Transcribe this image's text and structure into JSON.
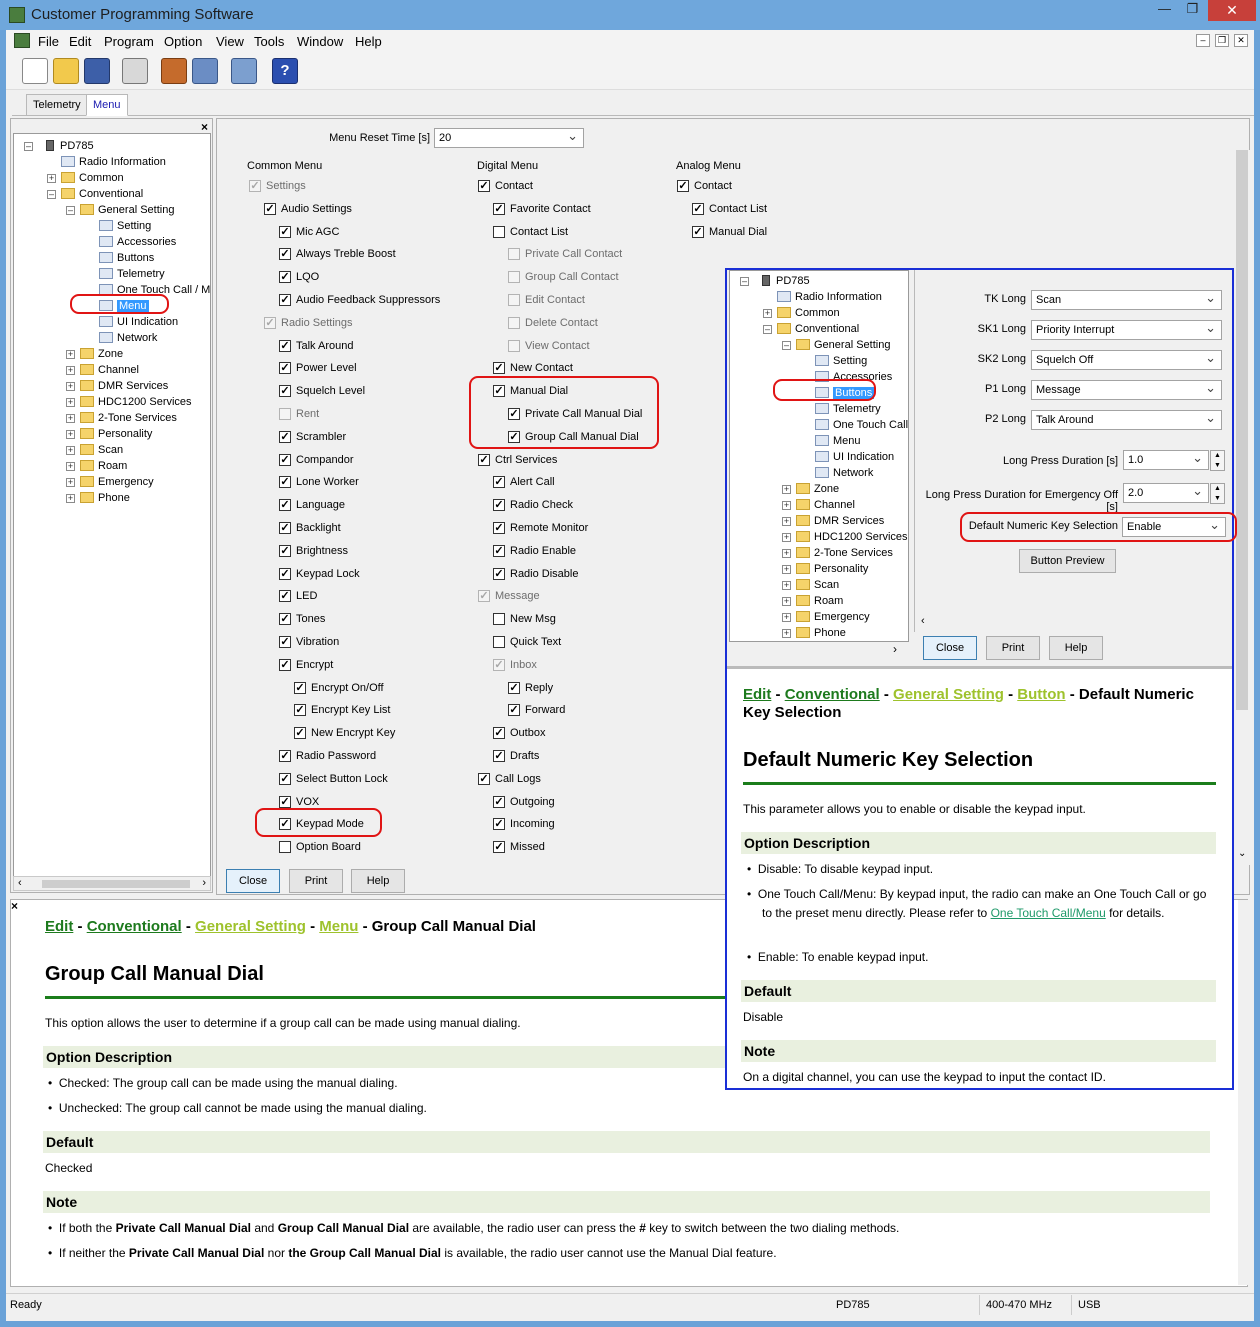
{
  "app_title": "Customer Programming Software",
  "menubar": [
    "File",
    "Edit",
    "Program",
    "Option",
    "View",
    "Tools",
    "Window",
    "Help"
  ],
  "tabs": [
    "Telemetry",
    "Menu"
  ],
  "tree": {
    "root": "PD785",
    "items": [
      {
        "label": "Radio Information",
        "level": 1,
        "type": "leaf"
      },
      {
        "label": "Common",
        "level": 1,
        "type": "folder"
      },
      {
        "label": "Conventional",
        "level": 1,
        "type": "folder"
      },
      {
        "label": "General Setting",
        "level": 2,
        "type": "folder"
      },
      {
        "label": "Setting",
        "level": 3,
        "type": "leaf"
      },
      {
        "label": "Accessories",
        "level": 3,
        "type": "leaf"
      },
      {
        "label": "Buttons",
        "level": 3,
        "type": "leaf"
      },
      {
        "label": "Telemetry",
        "level": 3,
        "type": "leaf"
      },
      {
        "label": "One Touch Call / Me",
        "level": 3,
        "type": "leaf"
      },
      {
        "label": "Menu",
        "level": 3,
        "type": "leaf"
      },
      {
        "label": "UI Indication",
        "level": 3,
        "type": "leaf"
      },
      {
        "label": "Network",
        "level": 3,
        "type": "leaf"
      },
      {
        "label": "Zone",
        "level": 2,
        "type": "folder"
      },
      {
        "label": "Channel",
        "level": 2,
        "type": "folder"
      },
      {
        "label": "DMR Services",
        "level": 2,
        "type": "folder"
      },
      {
        "label": "HDC1200 Services",
        "level": 2,
        "type": "folder"
      },
      {
        "label": "2-Tone Services",
        "level": 2,
        "type": "folder"
      },
      {
        "label": "Personality",
        "level": 2,
        "type": "folder"
      },
      {
        "label": "Scan",
        "level": 2,
        "type": "folder"
      },
      {
        "label": "Roam",
        "level": 2,
        "type": "folder"
      },
      {
        "label": "Emergency",
        "level": 2,
        "type": "folder"
      },
      {
        "label": "Phone",
        "level": 2,
        "type": "folder"
      }
    ]
  },
  "menu_panel": {
    "reset_label": "Menu Reset Time [s]",
    "reset_value": "20",
    "headers": [
      "Common Menu",
      "Digital Menu",
      "Analog Menu"
    ],
    "common": [
      {
        "l": "Settings",
        "c": true,
        "d": true,
        "i": 0
      },
      {
        "l": "Audio Settings",
        "c": true,
        "d": false,
        "i": 1
      },
      {
        "l": "Mic AGC",
        "c": true,
        "d": false,
        "i": 2
      },
      {
        "l": "Always Treble Boost",
        "c": true,
        "d": false,
        "i": 2
      },
      {
        "l": "LQO",
        "c": true,
        "d": false,
        "i": 2
      },
      {
        "l": "Audio Feedback Suppressors",
        "c": true,
        "d": false,
        "i": 2
      },
      {
        "l": "Radio Settings",
        "c": true,
        "d": true,
        "i": 1
      },
      {
        "l": "Talk Around",
        "c": true,
        "d": false,
        "i": 2
      },
      {
        "l": "Power Level",
        "c": true,
        "d": false,
        "i": 2
      },
      {
        "l": "Squelch Level",
        "c": true,
        "d": false,
        "i": 2
      },
      {
        "l": "Rent",
        "c": false,
        "d": true,
        "i": 2
      },
      {
        "l": "Scrambler",
        "c": true,
        "d": false,
        "i": 2
      },
      {
        "l": "Compandor",
        "c": true,
        "d": false,
        "i": 2
      },
      {
        "l": "Lone Worker",
        "c": true,
        "d": false,
        "i": 2
      },
      {
        "l": "Language",
        "c": true,
        "d": false,
        "i": 2
      },
      {
        "l": "Backlight",
        "c": true,
        "d": false,
        "i": 2
      },
      {
        "l": "Brightness",
        "c": true,
        "d": false,
        "i": 2
      },
      {
        "l": "Keypad Lock",
        "c": true,
        "d": false,
        "i": 2
      },
      {
        "l": "LED",
        "c": true,
        "d": false,
        "i": 2
      },
      {
        "l": "Tones",
        "c": true,
        "d": false,
        "i": 2
      },
      {
        "l": "Vibration",
        "c": true,
        "d": false,
        "i": 2
      },
      {
        "l": "Encrypt",
        "c": true,
        "d": false,
        "i": 2
      },
      {
        "l": "Encrypt On/Off",
        "c": true,
        "d": false,
        "i": 3
      },
      {
        "l": "Encrypt Key List",
        "c": true,
        "d": false,
        "i": 3
      },
      {
        "l": "New Encrypt Key",
        "c": true,
        "d": false,
        "i": 3
      },
      {
        "l": "Radio Password",
        "c": true,
        "d": false,
        "i": 2
      },
      {
        "l": "Select Button Lock",
        "c": true,
        "d": false,
        "i": 2
      },
      {
        "l": "VOX",
        "c": true,
        "d": false,
        "i": 2
      },
      {
        "l": "Keypad Mode",
        "c": true,
        "d": false,
        "i": 2
      },
      {
        "l": "Option Board",
        "c": false,
        "d": false,
        "i": 2
      }
    ],
    "digital": [
      {
        "l": "Contact",
        "c": true,
        "d": false,
        "i": 0
      },
      {
        "l": "Favorite Contact",
        "c": true,
        "d": false,
        "i": 1
      },
      {
        "l": "Contact List",
        "c": false,
        "d": false,
        "i": 1
      },
      {
        "l": "Private Call Contact",
        "c": false,
        "d": true,
        "i": 2
      },
      {
        "l": "Group Call Contact",
        "c": false,
        "d": true,
        "i": 2
      },
      {
        "l": "Edit Contact",
        "c": false,
        "d": true,
        "i": 2
      },
      {
        "l": "Delete Contact",
        "c": false,
        "d": true,
        "i": 2
      },
      {
        "l": "View Contact",
        "c": false,
        "d": true,
        "i": 2
      },
      {
        "l": "New Contact",
        "c": true,
        "d": false,
        "i": 1
      },
      {
        "l": "Manual Dial",
        "c": true,
        "d": false,
        "i": 1
      },
      {
        "l": "Private Call Manual Dial",
        "c": true,
        "d": false,
        "i": 2
      },
      {
        "l": "Group Call Manual Dial",
        "c": true,
        "d": false,
        "i": 2
      },
      {
        "l": "Ctrl Services",
        "c": true,
        "d": false,
        "i": 0
      },
      {
        "l": "Alert Call",
        "c": true,
        "d": false,
        "i": 1
      },
      {
        "l": "Radio Check",
        "c": true,
        "d": false,
        "i": 1
      },
      {
        "l": "Remote Monitor",
        "c": true,
        "d": false,
        "i": 1
      },
      {
        "l": "Radio Enable",
        "c": true,
        "d": false,
        "i": 1
      },
      {
        "l": "Radio Disable",
        "c": true,
        "d": false,
        "i": 1
      },
      {
        "l": "Message",
        "c": true,
        "d": true,
        "i": 0
      },
      {
        "l": "New Msg",
        "c": false,
        "d": false,
        "i": 1
      },
      {
        "l": "Quick Text",
        "c": false,
        "d": false,
        "i": 1
      },
      {
        "l": "Inbox",
        "c": true,
        "d": true,
        "i": 1
      },
      {
        "l": "Reply",
        "c": true,
        "d": false,
        "i": 2
      },
      {
        "l": "Forward",
        "c": true,
        "d": false,
        "i": 2
      },
      {
        "l": "Outbox",
        "c": true,
        "d": false,
        "i": 1
      },
      {
        "l": "Drafts",
        "c": true,
        "d": false,
        "i": 1
      },
      {
        "l": "Call Logs",
        "c": true,
        "d": false,
        "i": 0
      },
      {
        "l": "Outgoing",
        "c": true,
        "d": false,
        "i": 1
      },
      {
        "l": "Incoming",
        "c": true,
        "d": false,
        "i": 1
      },
      {
        "l": "Missed",
        "c": true,
        "d": false,
        "i": 1
      }
    ],
    "analog": [
      {
        "l": "Contact",
        "c": true,
        "d": false,
        "i": 0
      },
      {
        "l": "Contact List",
        "c": true,
        "d": false,
        "i": 1
      },
      {
        "l": "Manual Dial",
        "c": true,
        "d": false,
        "i": 1
      }
    ],
    "buttons": [
      "Close",
      "Print",
      "Help"
    ]
  },
  "help_main": {
    "crumbs": [
      "Edit",
      "Conventional",
      "General Setting",
      "Menu"
    ],
    "current": "Group Call Manual Dial",
    "title": "Group Call Manual Dial",
    "intro": "This option allows the user to determine if a group call can be made using manual dialing.",
    "opt_header": "Option Description",
    "options": [
      "Checked: The group call can be made using the manual dialing.",
      "Unchecked: The group call cannot be made using the manual dialing."
    ],
    "default_header": "Default",
    "default_value": "Checked",
    "note_header": "Note",
    "note1": {
      "a": "If both the ",
      "b": "Private Call Manual Dial",
      "c": " and ",
      "d": "Group Call Manual Dial",
      "e": " are available, the radio user can press the ",
      "f": "#",
      "g": " key to switch between the two dialing methods."
    },
    "note2": {
      "a": "If neither the ",
      "b": "Private Call Manual Dial",
      "c": " nor ",
      "d": "the Group Call Manual Dial",
      "e": " is available, the radio user cannot use the Manual Dial feature."
    }
  },
  "buttons_panel": {
    "rows": [
      {
        "label": "TK Long",
        "value": "Scan"
      },
      {
        "label": "SK1 Long",
        "value": "Priority Interrupt"
      },
      {
        "label": "SK2 Long",
        "value": "Squelch Off"
      },
      {
        "label": "P1 Long",
        "value": "Message"
      },
      {
        "label": "P2 Long",
        "value": "Talk Around"
      }
    ],
    "long_press_label": "Long Press Duration [s]",
    "long_press_value": "1.0",
    "emergency_label": "Long Press Duration for Emergency Off [s]",
    "emergency_value": "2.0",
    "numeric_label": "Default Numeric Key Selection",
    "numeric_value": "Enable",
    "preview_button": "Button Preview",
    "buttons": [
      "Close",
      "Print",
      "Help"
    ]
  },
  "help_inset": {
    "crumbs": [
      "Edit",
      "Conventional",
      "General Setting",
      "Button"
    ],
    "current": "Default Numeric Key Selection",
    "title": "Default Numeric Key Selection",
    "intro": "This parameter allows you to enable or disable the keypad input.",
    "opt_header": "Option Description",
    "opt1": "Disable: To disable keypad input.",
    "opt2a": "One Touch Call/Menu: By keypad input, the radio can make an One Touch Call or go to the preset menu directly. Please refer to ",
    "opt2link": "One Touch Call/Menu",
    "opt2b": " for details.",
    "opt3": "Enable: To enable keypad input.",
    "default_header": "Default",
    "default_value": "Disable",
    "note_header": "Note",
    "note": "On a digital channel, you can use the keypad to input the contact ID."
  },
  "statusbar": {
    "left": "Ready",
    "model": "PD785",
    "band": "400-470 MHz",
    "port": "USB"
  },
  "colors": {
    "highlight_red": "#e01414",
    "inset_border": "#1a2fd6",
    "green_link": "#1d7a1d",
    "olive_link": "#9ec22c"
  }
}
